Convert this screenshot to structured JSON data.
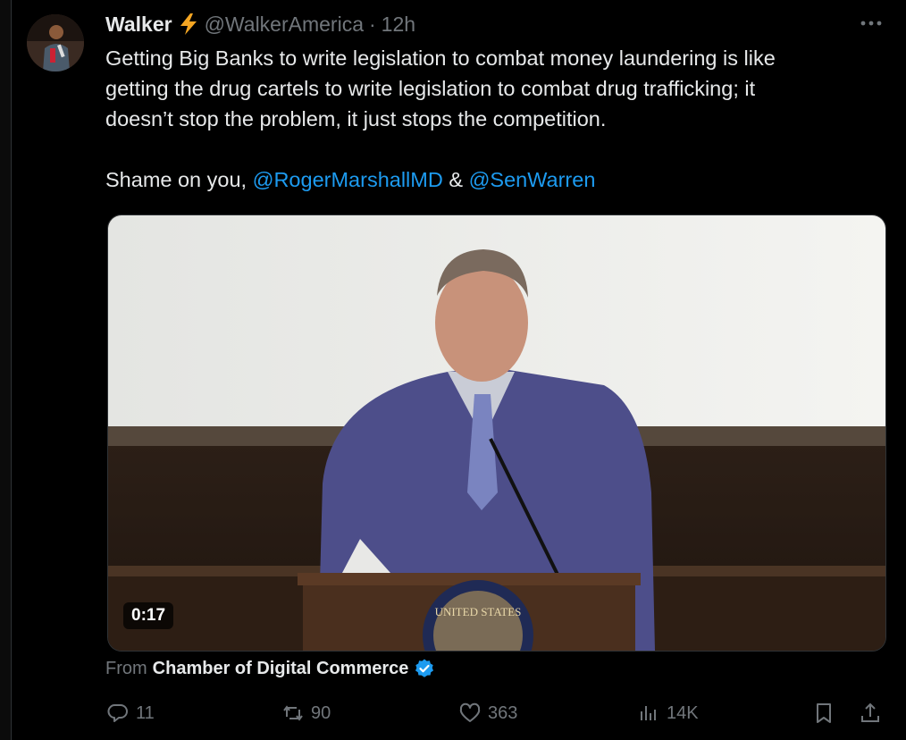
{
  "tweet": {
    "display_name": "Walker",
    "handle": "@WalkerAmerica",
    "separator": "·",
    "time": "12h",
    "text_line1": "Getting Big Banks to write legislation to combat money laundering is like",
    "text_line2": "getting the drug cartels to write legislation to combat drug trafficking; it",
    "text_line3": "doesn’t stop the problem, it just stops the competition.",
    "shame_prefix": "Shame on you, ",
    "mention1": "@RogerMarshallMD",
    "ampersand": " & ",
    "mention2": "@SenWarren",
    "video_duration": "0:17",
    "from_label": "From",
    "from_source": "Chamber of Digital Commerce"
  },
  "metrics": {
    "replies": "11",
    "reposts": "90",
    "likes": "363",
    "views": "14K"
  },
  "icons": {
    "name_badge": "lightning-bolt-icon",
    "more": "more-horizontal-icon",
    "verified": "verified-badge-icon",
    "reply": "reply-icon",
    "repost": "repost-icon",
    "like": "heart-icon",
    "views": "views-icon",
    "bookmark": "bookmark-icon",
    "share": "share-icon"
  },
  "colors": {
    "background": "#000000",
    "text": "#e7e9ea",
    "muted": "#71767b",
    "link": "#1d9bf0",
    "bolt": "#f5a623"
  }
}
